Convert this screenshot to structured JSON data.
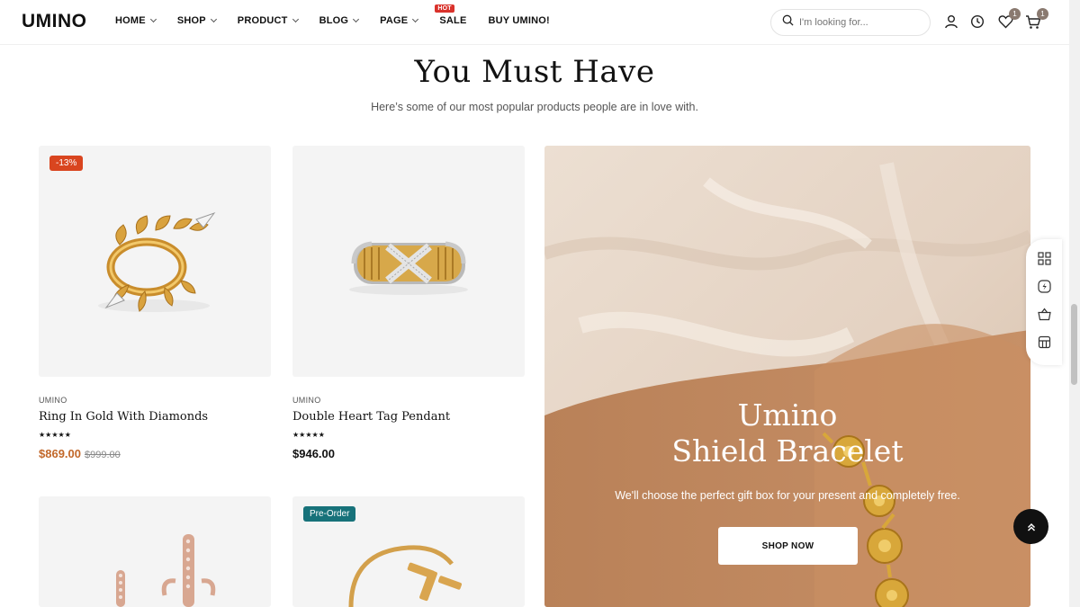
{
  "header": {
    "logo": "UMINO",
    "nav": [
      {
        "label": "HOME",
        "dropdown": true
      },
      {
        "label": "SHOP",
        "dropdown": true
      },
      {
        "label": "PRODUCT",
        "dropdown": true
      },
      {
        "label": "BLOG",
        "dropdown": true
      },
      {
        "label": "PAGE",
        "dropdown": true
      },
      {
        "label": "SALE",
        "dropdown": false,
        "badge": "HOT"
      },
      {
        "label": "BUY UMINO!",
        "dropdown": false
      }
    ],
    "search_placeholder": "I'm looking for...",
    "wishlist_count": "1",
    "cart_count": "1",
    "icons": [
      "search-icon",
      "user-icon",
      "history-icon",
      "heart-icon",
      "cart-icon"
    ]
  },
  "section": {
    "title": "You Must Have",
    "subtitle": "Here’s some of our most popular products people are in love with."
  },
  "products": [
    {
      "badge": "-13%",
      "badge_color": "#d9451f",
      "brand": "UMINO",
      "name": "Ring In Gold With Diamonds",
      "stars": "★★★★★",
      "price": "$869.00",
      "old_price": "$999.00"
    },
    {
      "brand": "UMINO",
      "name": "Double Heart Tag Pendant",
      "stars": "★★★★★",
      "price": "$946.00"
    },
    {
      "brand": "",
      "name": ""
    },
    {
      "badge": "Pre-Order",
      "badge_color": "#17727a",
      "brand": "",
      "name": ""
    }
  ],
  "banner": {
    "title_line1": "Umino",
    "title_line2": "Shield Bracelet",
    "description": "We'll choose the perfect gift box for your present and completely free.",
    "button": "SHOP NOW"
  },
  "colors": {
    "accent": "#c2682a",
    "sale_badge": "#d9451f",
    "preorder_badge": "#17727a",
    "hot_badge": "#d9322b"
  }
}
